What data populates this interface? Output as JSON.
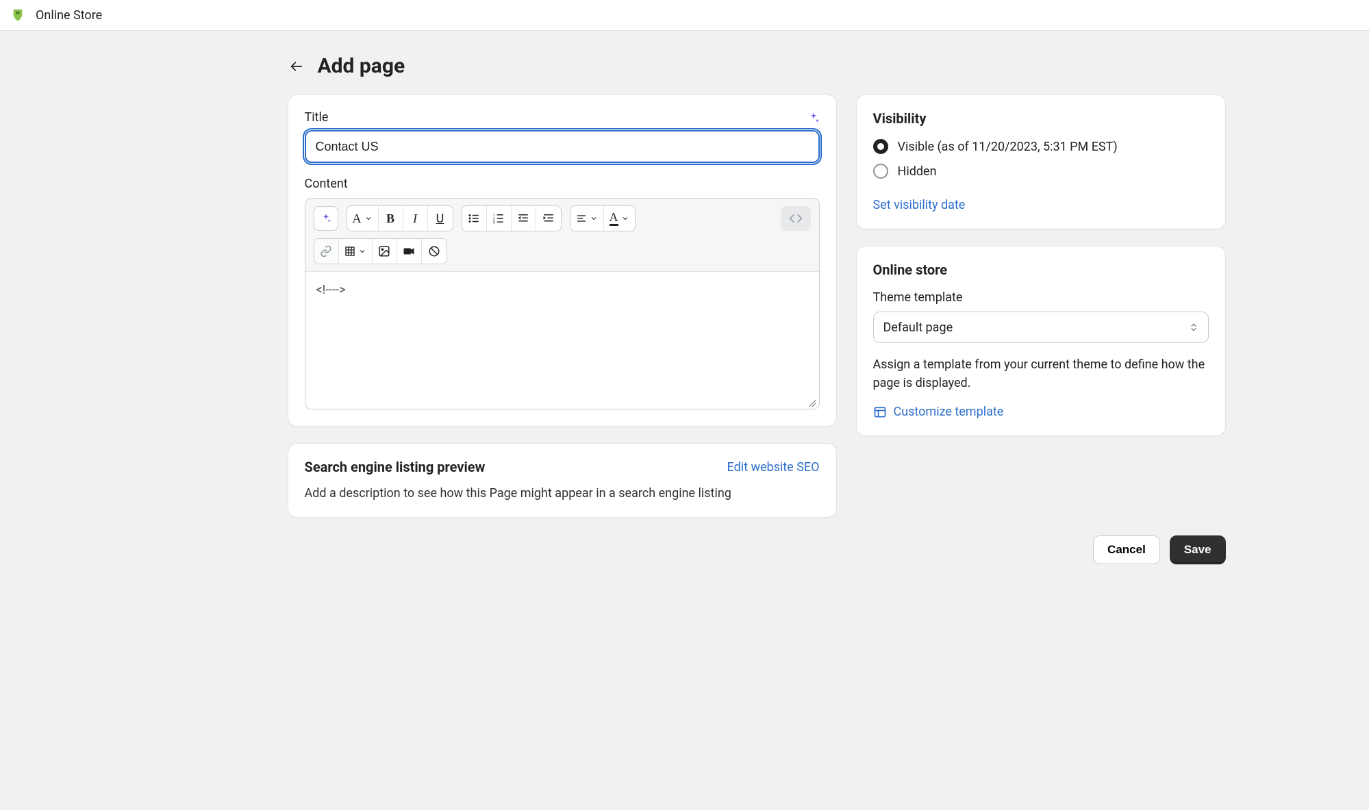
{
  "topbar": {
    "title": "Online Store"
  },
  "header": {
    "title": "Add page"
  },
  "main": {
    "title_label": "Title",
    "title_value": "Contact US",
    "content_label": "Content",
    "content_text": "<!---->"
  },
  "seo": {
    "heading": "Search engine listing preview",
    "edit_link": "Edit website SEO",
    "description": "Add a description to see how this Page might appear in a search engine listing"
  },
  "visibility": {
    "heading": "Visibility",
    "options": {
      "visible": "Visible (as of 11/20/2023, 5:31 PM EST)",
      "hidden": "Hidden"
    },
    "set_date_link": "Set visibility date"
  },
  "online_store": {
    "heading": "Online store",
    "template_label": "Theme template",
    "template_value": "Default page",
    "description": "Assign a template from your current theme to define how the page is displayed.",
    "customize_link": "Customize template"
  },
  "footer": {
    "cancel": "Cancel",
    "save": "Save"
  }
}
